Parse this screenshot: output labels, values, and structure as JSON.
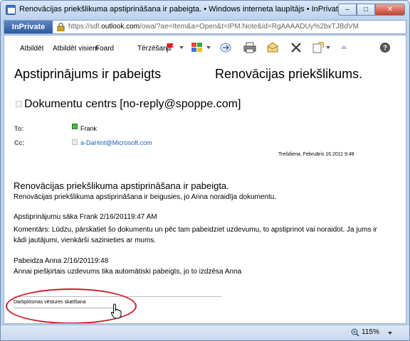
{
  "window": {
    "title": "Renovācijas priekšlikuma apstiprināšana ir pabeigta. • Windows interneta laupītājs • InPrivatel",
    "buttons": {
      "minimize": "–",
      "maximize": "□",
      "close": "✕"
    }
  },
  "address_bar": {
    "inprivate_label": "InPrivate",
    "url_prefix": "https://sdf.",
    "url_domain": "outlook.com",
    "url_rest": "/owa/?ae=Item&a=Open&t=IPM.Note&id=RgAAAADUy%2bxTJBdVM"
  },
  "toolbar": {
    "reply": "Atbildēt",
    "reply_all": "Atbildēt visiem",
    "forward": "Foard",
    "print_label": "Tērzēšana"
  },
  "message": {
    "subject_left": "Apstiprinājums ir pabeigts",
    "subject_right": "Renovācijas priekšlikums.",
    "sender": "Dokumentu centrs [no-reply@spoppe.com]",
    "to_label": "To:",
    "to_value": "Frank",
    "cc_label": "Cc:",
    "cc_value": "a-DaHint@Microsoft.com",
    "date": "Trešdiena. Februāris 16.2011 9:48"
  },
  "body": {
    "heading": "Renovācijas priekšlikuma apstiprināšana ir pabeigta.",
    "line1": "Renovācijas priekšlikuma apstiprināšana ir beigusies, jo Anna noraidīja dokumentu.",
    "started": "Apstiprinājumu sāka Frank 2/16/20119:47 AM",
    "comment": "Komentārs: Lūdzu, pārskatiet šo dokumentu un pēc tam pabeidziet uzdevumu, to apstiprinot vai noraidot. Ja jums ir kādi jautājumi, vienkārši sazinieties ar mums.",
    "finished": "Pabeidza Anna 2/16/20119:48",
    "auto_completed": "Annai piešķirtais uzdevums tika automātiski pabeigts, jo to izdzēsa Anna",
    "workflow_link": "Darbplūsmas vēstures skatīšana"
  },
  "statusbar": {
    "zoom": "115%"
  },
  "colors": {
    "frame": "#bcd3ee",
    "link": "#1a62b8",
    "annotation": "#c8202a"
  },
  "icons": [
    "app-icon",
    "lock-icon",
    "print-icon",
    "categories-icon",
    "move-icon",
    "print-icon-2",
    "flag-icon",
    "delete-icon",
    "move-to-folder-icon",
    "up-arrow-icon",
    "help-icon",
    "zoom-icon",
    "hand-cursor-icon"
  ]
}
